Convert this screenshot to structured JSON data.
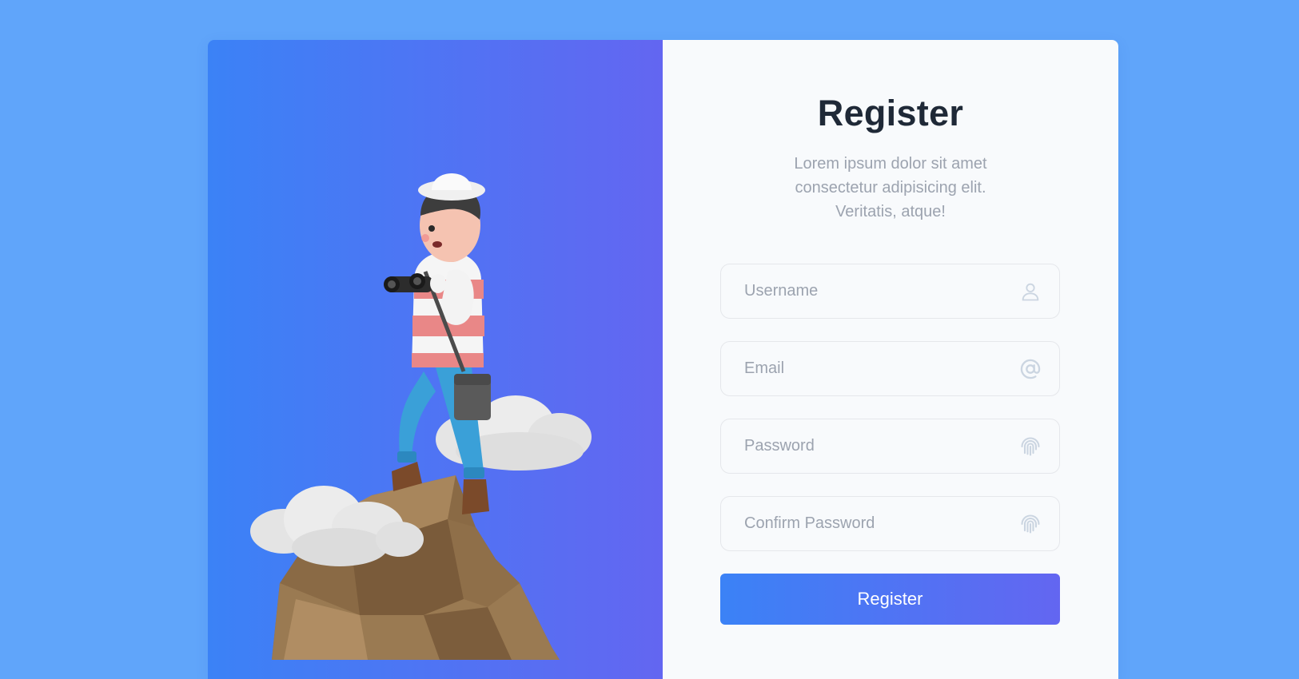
{
  "form": {
    "title": "Register",
    "subtitle_lines": [
      "Lorem ipsum dolor sit amet",
      "consectetur adipisicing elit.",
      "Veritatis, atque!"
    ],
    "fields": [
      {
        "placeholder": "Username",
        "value": "",
        "icon": "user-icon"
      },
      {
        "placeholder": "Email",
        "value": "",
        "icon": "at-sign-icon"
      },
      {
        "placeholder": "Password",
        "value": "",
        "icon": "fingerprint-icon"
      },
      {
        "placeholder": "Confirm Password",
        "value": "",
        "icon": "fingerprint-icon"
      }
    ],
    "submit_label": "Register"
  },
  "hero": {
    "illustration": "explorer-with-binoculars-on-rock"
  },
  "colors": {
    "page_background": "#60a5fa",
    "gradient_start": "#3b82f6",
    "gradient_end": "#6366f1",
    "panel_background": "#f8fafc",
    "title_text": "#1f2937",
    "muted_text": "#9ca3af",
    "icon": "#cbd5e1"
  }
}
